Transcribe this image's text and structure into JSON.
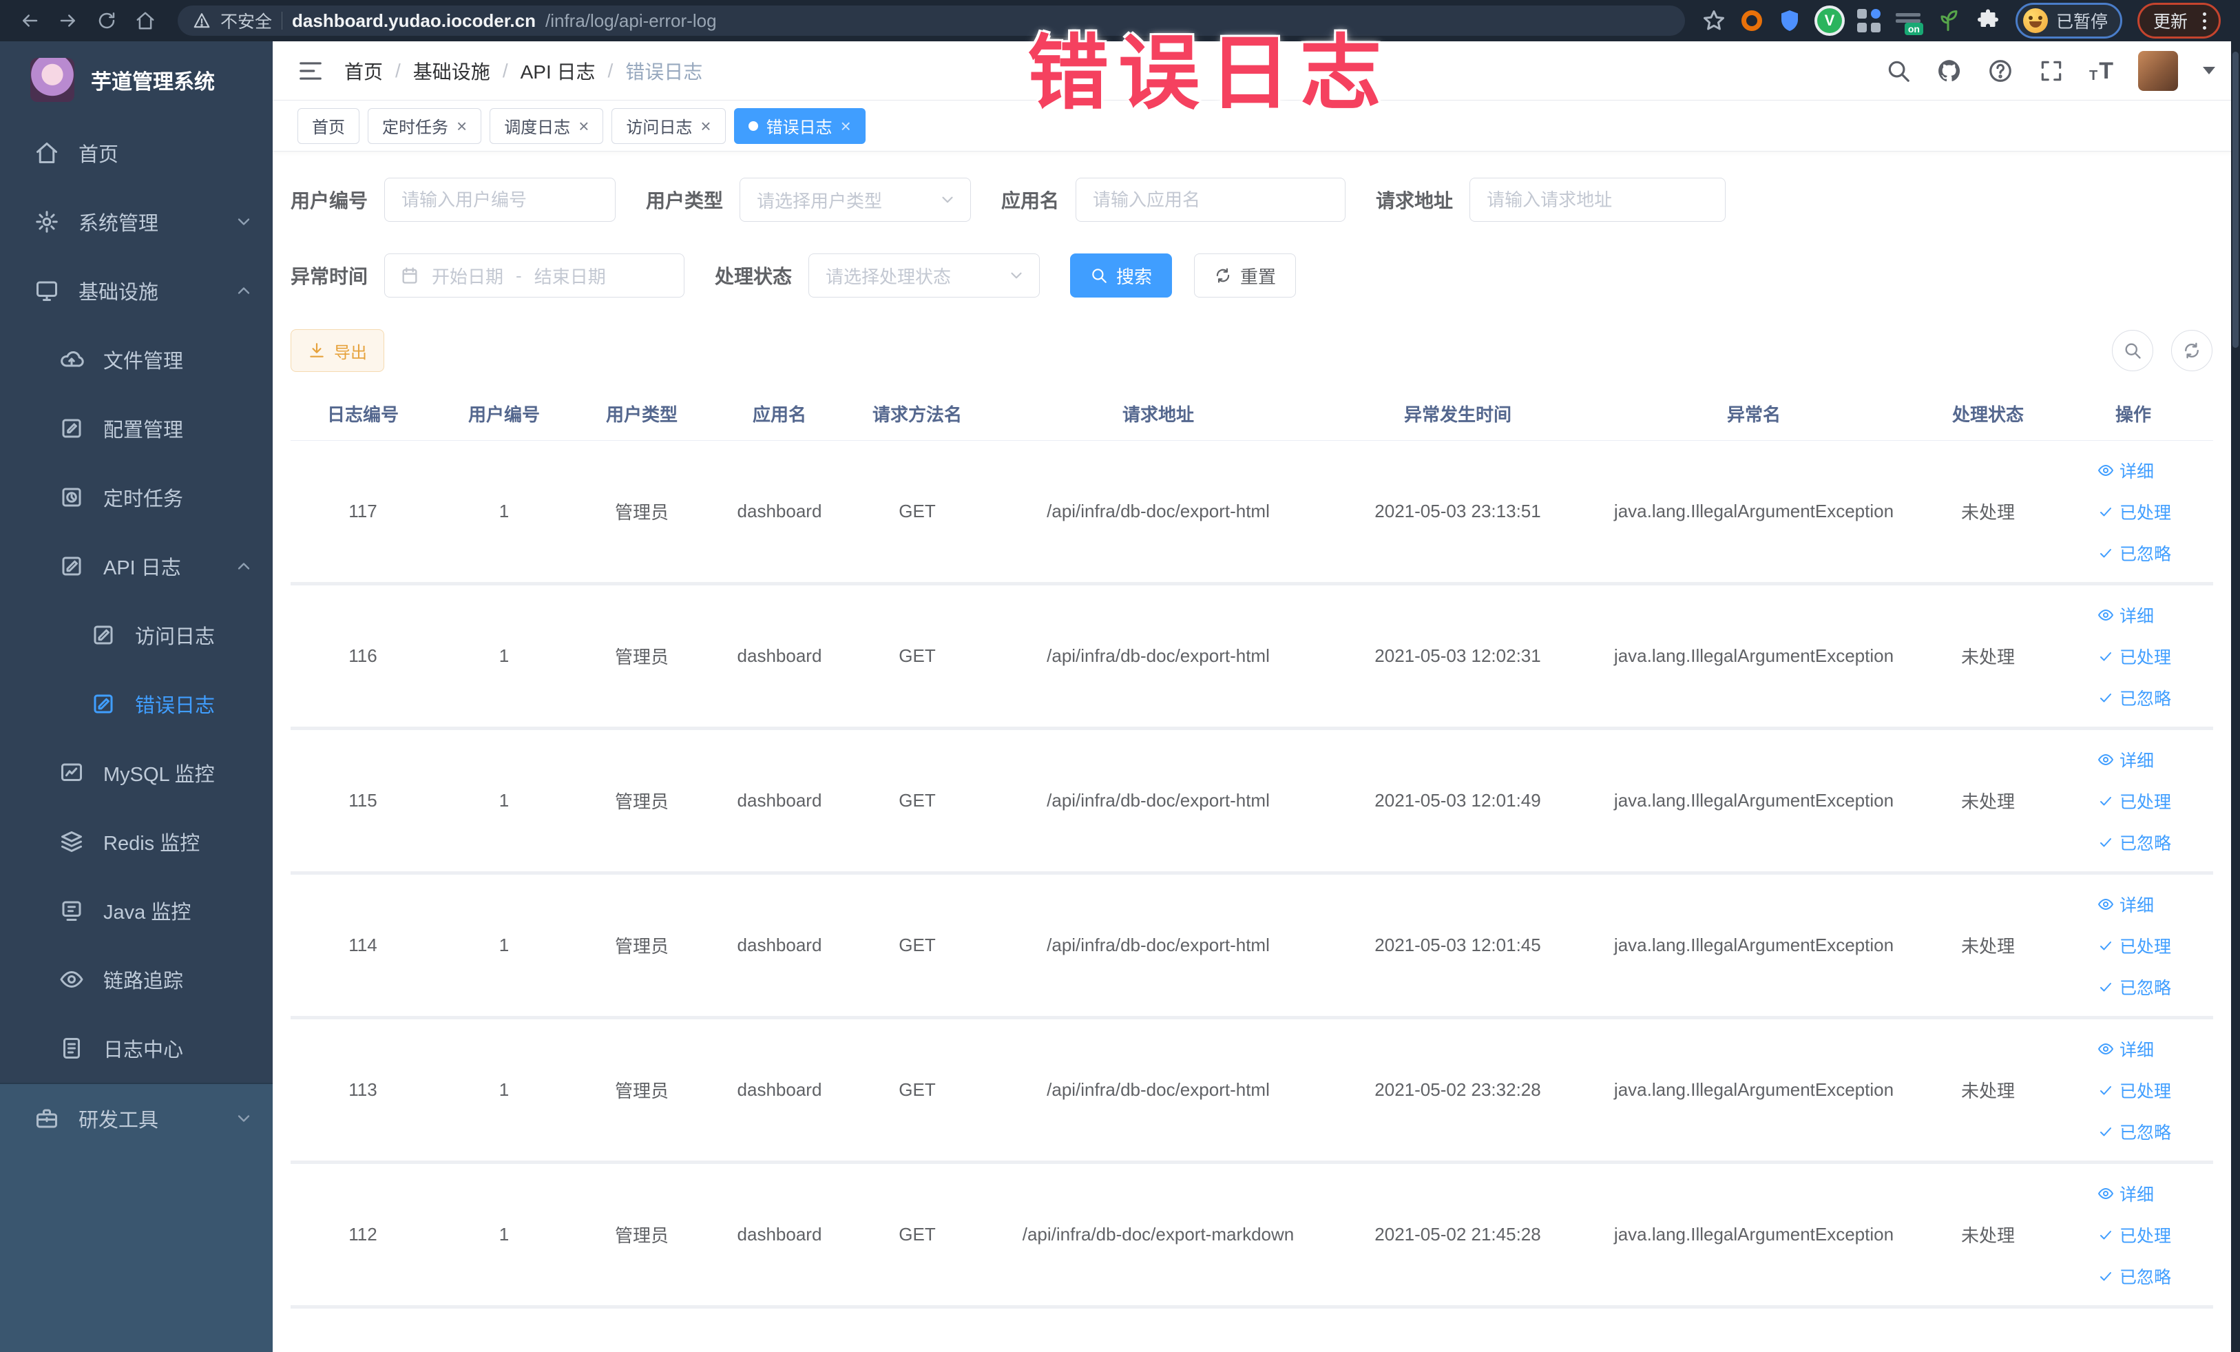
{
  "browser": {
    "security_label": "不安全",
    "url_domain": "dashboard.yudao.iocoder.cn",
    "url_path": "/infra/log/api-error-log",
    "extension_v_letter": "V",
    "on_badge_label": "on",
    "paused_badge": "已暂停",
    "update_button": "更新"
  },
  "overlay": {
    "text": "错误日志"
  },
  "sidebar": {
    "logo_title": "芋道管理系统",
    "items": [
      {
        "label": "首页",
        "icon": "home-icon",
        "level": 1
      },
      {
        "label": "系统管理",
        "icon": "gear-icon",
        "level": 1,
        "chevron": "down"
      },
      {
        "label": "基础设施",
        "icon": "monitor-icon",
        "level": 1,
        "chevron": "up"
      },
      {
        "label": "文件管理",
        "icon": "cloud-upload-icon",
        "level": 2
      },
      {
        "label": "配置管理",
        "icon": "edit-icon",
        "level": 2
      },
      {
        "label": "定时任务",
        "icon": "schedule-icon",
        "level": 2
      },
      {
        "label": "API 日志",
        "icon": "log-icon",
        "level": 2,
        "chevron": "up"
      },
      {
        "label": "访问日志",
        "icon": "log-icon",
        "level": 3
      },
      {
        "label": "错误日志",
        "icon": "log-icon",
        "level": 3,
        "active": true
      },
      {
        "label": "MySQL 监控",
        "icon": "chart-icon",
        "level": 2
      },
      {
        "label": "Redis 监控",
        "icon": "layers-icon",
        "level": 2
      },
      {
        "label": "Java 监控",
        "icon": "java-icon",
        "level": 2
      },
      {
        "label": "链路追踪",
        "icon": "eye-icon",
        "level": 2
      },
      {
        "label": "日志中心",
        "icon": "doc-icon",
        "level": 2
      },
      {
        "label": "研发工具",
        "icon": "toolbox-icon",
        "level": 1,
        "chevron": "down",
        "section": "bottom"
      }
    ]
  },
  "header": {
    "breadcrumb": [
      {
        "label": "首页"
      },
      {
        "label": "基础设施"
      },
      {
        "label": "API 日志"
      },
      {
        "label": "错误日志",
        "current": true
      }
    ]
  },
  "tabs": [
    {
      "label": "首页",
      "closable": false,
      "active": false
    },
    {
      "label": "定时任务",
      "closable": true,
      "active": false
    },
    {
      "label": "调度日志",
      "closable": true,
      "active": false
    },
    {
      "label": "访问日志",
      "closable": true,
      "active": false
    },
    {
      "label": "错误日志",
      "closable": true,
      "active": true
    }
  ],
  "filters": {
    "user_id": {
      "label": "用户编号",
      "placeholder": "请输入用户编号"
    },
    "user_type": {
      "label": "用户类型",
      "placeholder": "请选择用户类型"
    },
    "app_name": {
      "label": "应用名",
      "placeholder": "请输入应用名"
    },
    "request_url": {
      "label": "请求地址",
      "placeholder": "请输入请求地址"
    },
    "exception_time": {
      "label": "异常时间",
      "start_placeholder": "开始日期",
      "separator": "-",
      "end_placeholder": "结束日期"
    },
    "process_status": {
      "label": "处理状态",
      "placeholder": "请选择处理状态"
    },
    "search_button": "搜索",
    "reset_button": "重置"
  },
  "toolbar": {
    "export_button": "导出"
  },
  "table": {
    "columns": [
      "日志编号",
      "用户编号",
      "用户类型",
      "应用名",
      "请求方法名",
      "请求地址",
      "异常发生时间",
      "异常名",
      "处理状态",
      "操作"
    ],
    "row_actions": [
      {
        "label": "详细",
        "icon": "eye-icon"
      },
      {
        "label": "已处理",
        "icon": "check-icon"
      },
      {
        "label": "已忽略",
        "icon": "check-icon"
      }
    ],
    "rows": [
      {
        "id": "117",
        "user_id": "1",
        "user_type": "管理员",
        "app": "dashboard",
        "method": "GET",
        "url": "/api/infra/db-doc/export-html",
        "time": "2021-05-03 23:13:51",
        "exception": "java.lang.IllegalArgumentException",
        "status": "未处理"
      },
      {
        "id": "116",
        "user_id": "1",
        "user_type": "管理员",
        "app": "dashboard",
        "method": "GET",
        "url": "/api/infra/db-doc/export-html",
        "time": "2021-05-03 12:02:31",
        "exception": "java.lang.IllegalArgumentException",
        "status": "未处理"
      },
      {
        "id": "115",
        "user_id": "1",
        "user_type": "管理员",
        "app": "dashboard",
        "method": "GET",
        "url": "/api/infra/db-doc/export-html",
        "time": "2021-05-03 12:01:49",
        "exception": "java.lang.IllegalArgumentException",
        "status": "未处理"
      },
      {
        "id": "114",
        "user_id": "1",
        "user_type": "管理员",
        "app": "dashboard",
        "method": "GET",
        "url": "/api/infra/db-doc/export-html",
        "time": "2021-05-03 12:01:45",
        "exception": "java.lang.IllegalArgumentException",
        "status": "未处理"
      },
      {
        "id": "113",
        "user_id": "1",
        "user_type": "管理员",
        "app": "dashboard",
        "method": "GET",
        "url": "/api/infra/db-doc/export-html",
        "time": "2021-05-02 23:32:28",
        "exception": "java.lang.IllegalArgumentException",
        "status": "未处理"
      },
      {
        "id": "112",
        "user_id": "1",
        "user_type": "管理员",
        "app": "dashboard",
        "method": "GET",
        "url": "/api/infra/db-doc/export-markdown",
        "time": "2021-05-02 21:45:28",
        "exception": "java.lang.IllegalArgumentException",
        "status": "未处理"
      }
    ]
  },
  "colors": {
    "accent": "#409eff",
    "sidebar_bg": "#304156",
    "overlay_pink": "#f5415f",
    "warning": "#e6a23c",
    "active_tab_bg": "#409eff"
  }
}
